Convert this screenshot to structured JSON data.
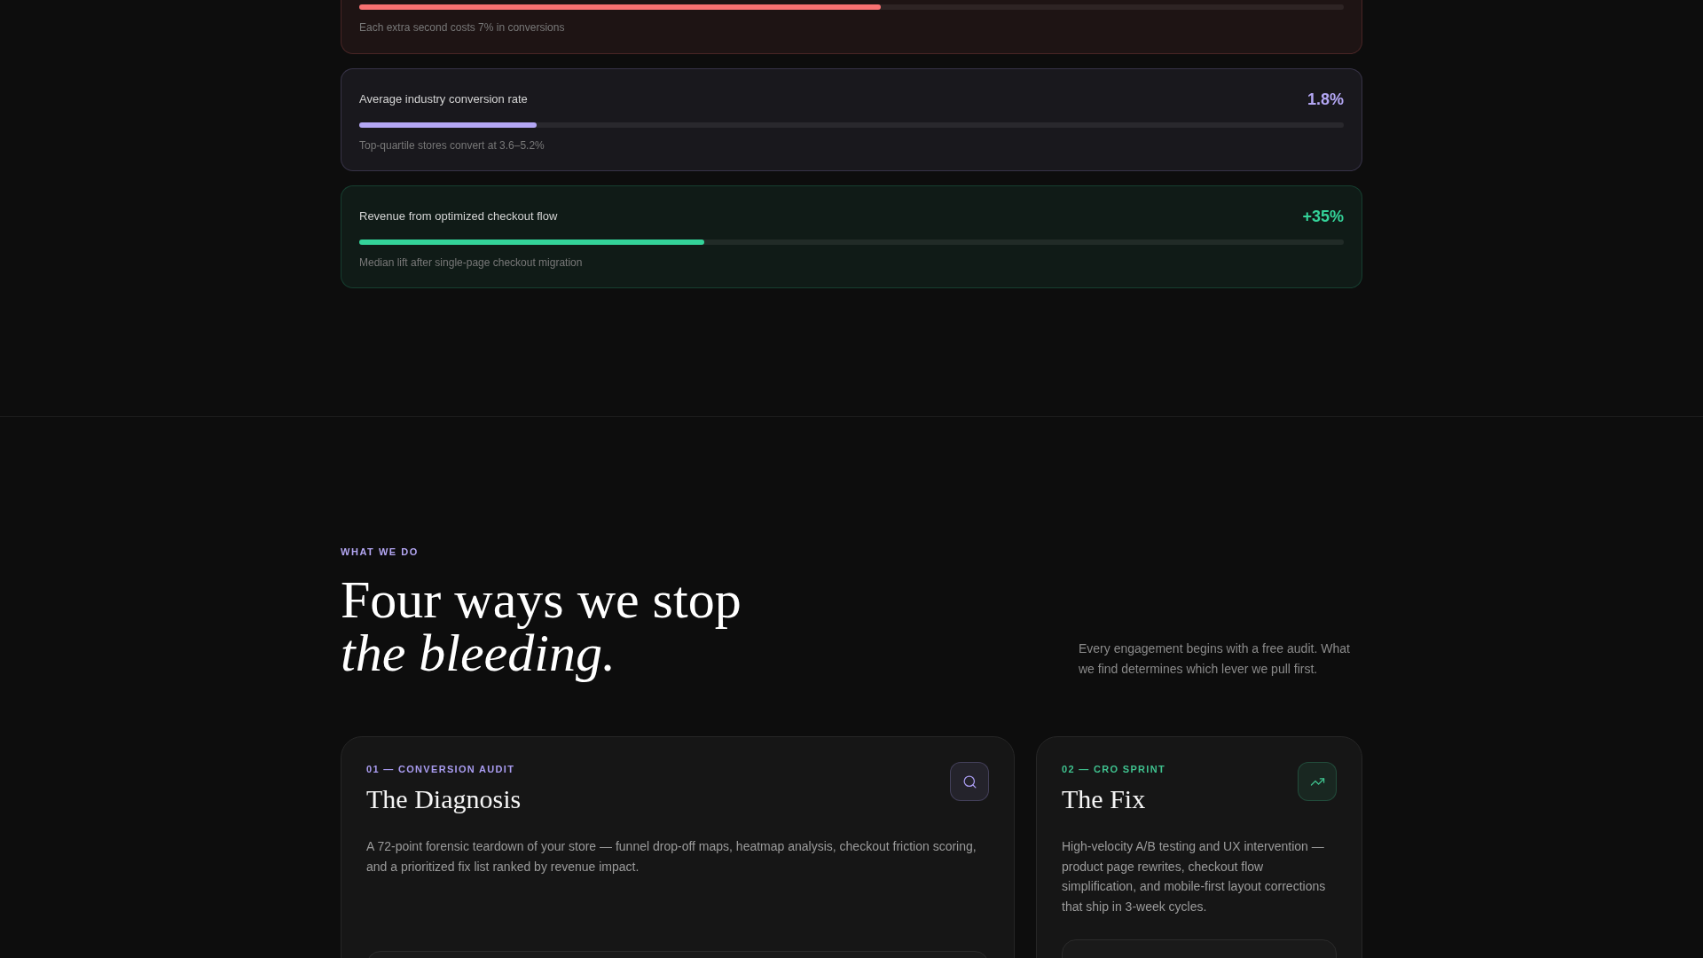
{
  "stats": [
    {
      "caption": "Each extra second costs 7% in conversions",
      "level": 0.53,
      "color": "#f87171"
    },
    {
      "label": "Average industry conversion rate",
      "value": "1.8%",
      "level": 0.18,
      "caption": "Top-quartile stores convert at 3.6–5.2%",
      "color": "#b4a7f5"
    },
    {
      "label": "Revenue from optimized checkout flow",
      "value": "+35%",
      "level": 0.35,
      "caption": "Median lift after single-page checkout migration",
      "color": "#34d399"
    }
  ],
  "services": {
    "eyebrow": "WHAT WE DO",
    "heading": "Four ways we stop *the bleeding.*",
    "intro": "Every engagement begins with a free audit. What we find determines which lever we pull first.",
    "cards": [
      {
        "kind": "audit",
        "tag": "01 — CONVERSION AUDIT",
        "title": "The Diagnosis",
        "description": "A 72-point forensic teardown of your store — funnel drop-off maps, heatmap analysis, checkout friction scoring, and a prioritized fix list ranked by revenue impact.",
        "color": "#a99cf0"
      },
      {
        "kind": "sprint",
        "tag": "02 — CRO SPRINT",
        "title": "The Fix",
        "description": "High-velocity A/B testing and UX intervention — product page rewrites, checkout flow simplification, and mobile-first layout corrections that ship in 3-week cycles.",
        "color": "#3fc18e"
      }
    ]
  }
}
